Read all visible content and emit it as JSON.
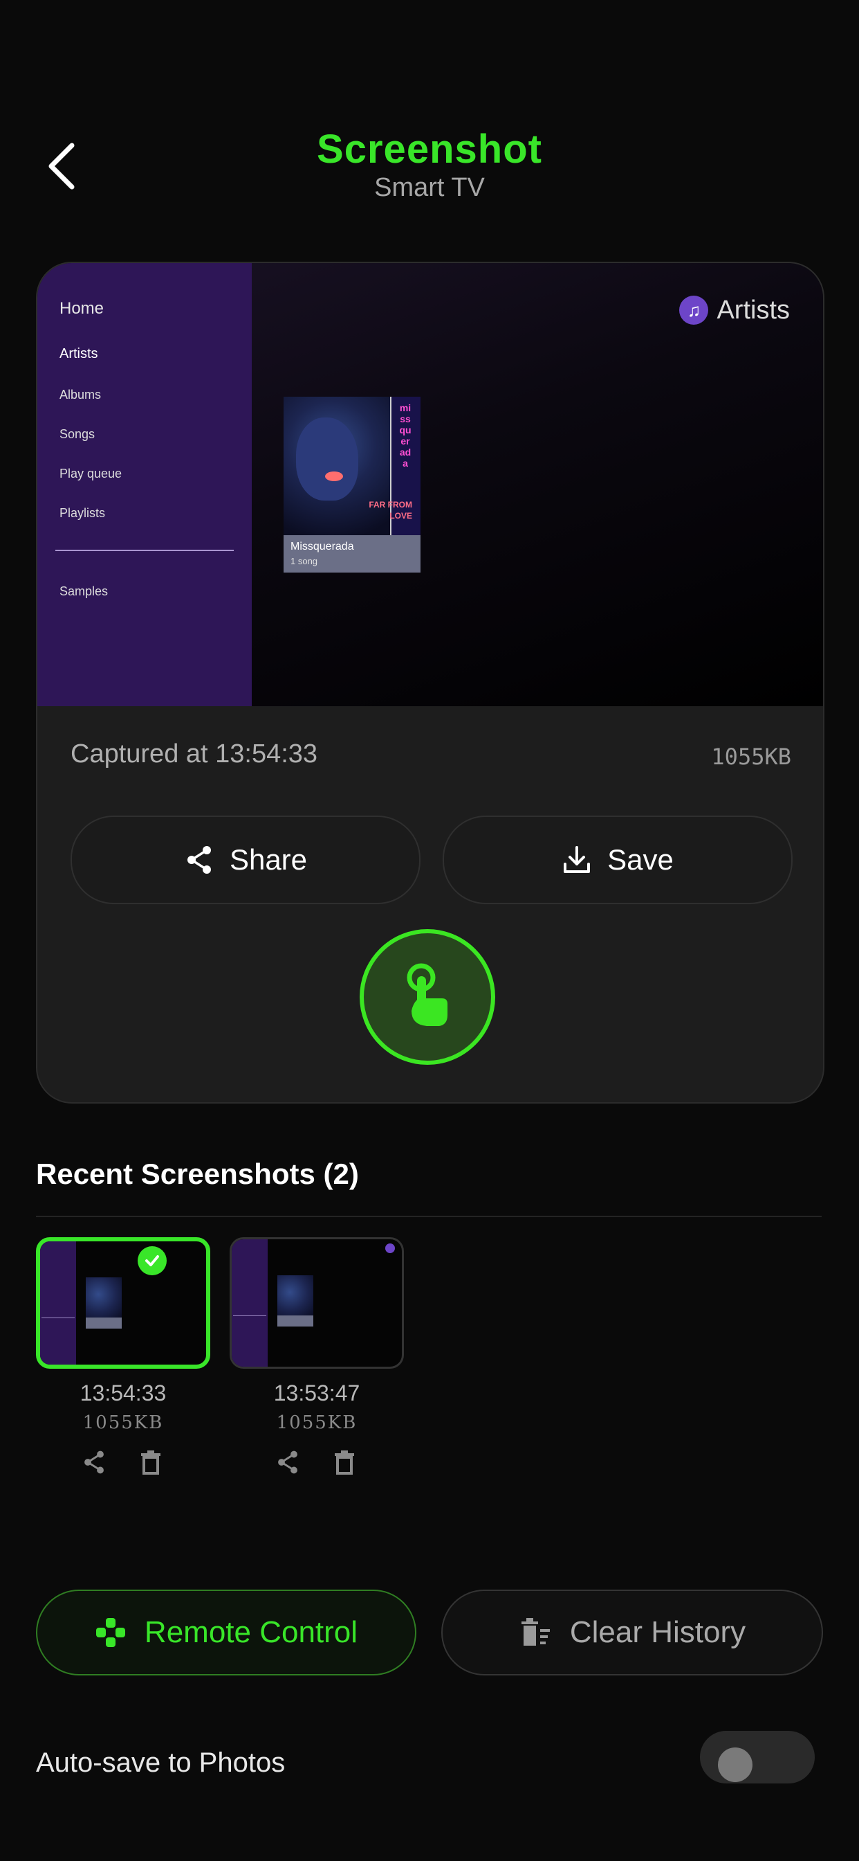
{
  "header": {
    "title": "Screenshot",
    "subtitle": "Smart TV"
  },
  "preview": {
    "sidebar": [
      "Home",
      "Artists",
      "Albums",
      "Songs",
      "Play queue",
      "Playlists",
      "Samples"
    ],
    "chip_label": "Artists",
    "album": {
      "name": "Missquerada",
      "sub": "1 song",
      "cover_text": "FAR FROM LOVE",
      "cover_vertical": "missquerada"
    }
  },
  "capture": {
    "captured_text": "Captured at 13:54:33",
    "size": "1055KB"
  },
  "actions": {
    "share": "Share",
    "save": "Save"
  },
  "recent": {
    "title": "Recent Screenshots (2)",
    "items": [
      {
        "time": "13:54:33",
        "size": "1055KB",
        "selected": true
      },
      {
        "time": "13:53:47",
        "size": "1055KB",
        "selected": false
      }
    ]
  },
  "bottom": {
    "remote": "Remote Control",
    "clear": "Clear History"
  },
  "settings": {
    "autosave_label": "Auto-save to Photos",
    "autosave_on": false
  },
  "colors": {
    "accent": "#39e629",
    "background": "#0a0a0a",
    "card": "#1d1d1d",
    "tv_sidebar": "#2e1657"
  }
}
